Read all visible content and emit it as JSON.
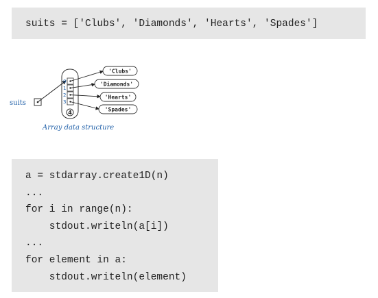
{
  "top_code": {
    "line": "suits = ['Clubs', 'Diamonds', 'Hearts', 'Spades']"
  },
  "diagram": {
    "variable_label": "suits",
    "indices": [
      "0",
      "1",
      "2",
      "3"
    ],
    "length": "4",
    "values": [
      "'Clubs'",
      "'Diamonds'",
      "'Hearts'",
      "'Spades'"
    ],
    "caption": "Array data structure",
    "caption_color": "#1f5fa8"
  },
  "bottom_code": {
    "lines": [
      "a = stdarray.create1D(n)",
      "...",
      "for i in range(n):",
      "    stdout.writeln(a[i])",
      "...",
      "for element in a:",
      "    stdout.writeln(element)"
    ]
  }
}
